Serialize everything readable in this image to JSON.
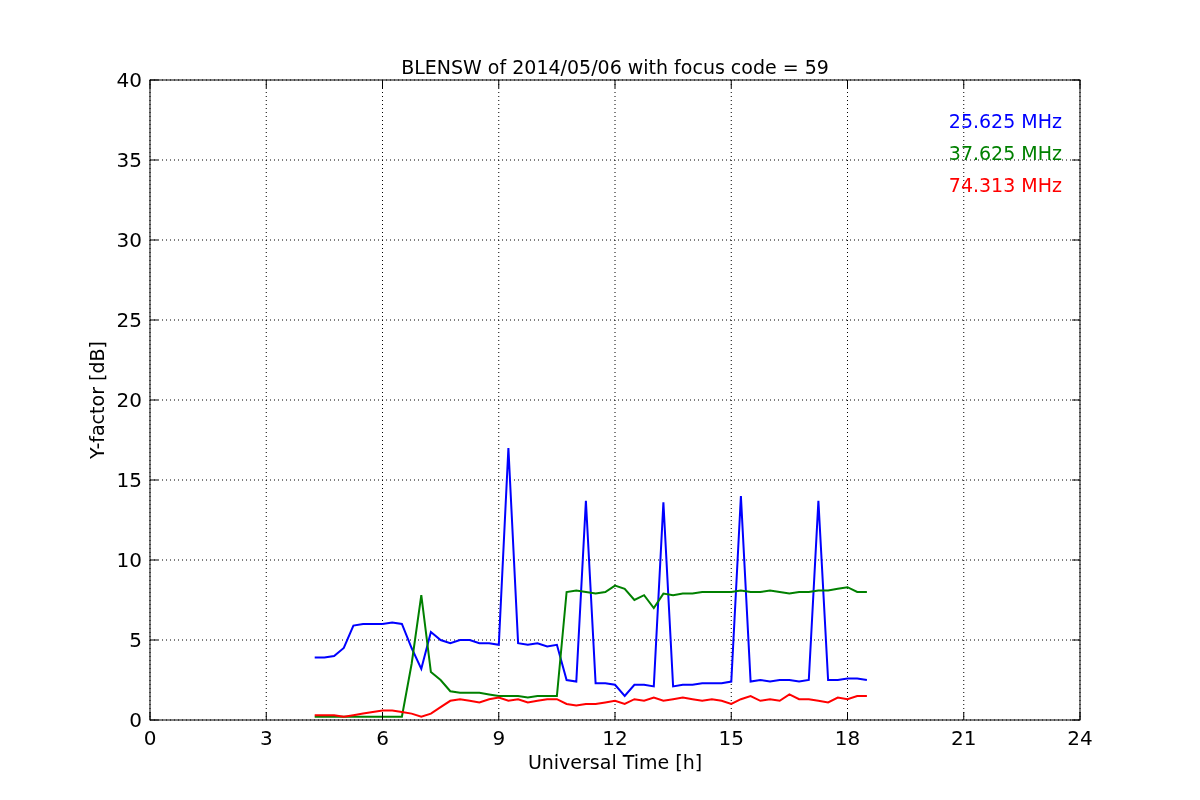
{
  "chart_data": {
    "type": "line",
    "title": "BLENSW of 2014/05/06 with focus code = 59",
    "xlabel": "Universal Time [h]",
    "ylabel": "Y-factor [dB]",
    "x": [
      4.25,
      4.5,
      4.75,
      5,
      5.25,
      5.5,
      5.75,
      6,
      6.25,
      6.5,
      6.75,
      7,
      7.25,
      7.5,
      7.75,
      8,
      8.25,
      8.5,
      8.75,
      9,
      9.25,
      9.5,
      9.75,
      10,
      10.25,
      10.5,
      10.75,
      11,
      11.25,
      11.5,
      11.75,
      12,
      12.25,
      12.5,
      12.75,
      13,
      13.25,
      13.5,
      13.75,
      14,
      14.25,
      14.5,
      14.75,
      15,
      15.25,
      15.5,
      15.75,
      16,
      16.25,
      16.5,
      16.75,
      17,
      17.25,
      17.5,
      17.75,
      18,
      18.25,
      18.5
    ],
    "series": [
      {
        "name": "25.625 MHz",
        "color": "#0000ff",
        "values": [
          3.9,
          3.9,
          4.0,
          4.5,
          5.9,
          6.0,
          6.0,
          6.0,
          6.1,
          6.0,
          4.5,
          3.2,
          5.5,
          5.0,
          4.8,
          5.0,
          5.0,
          4.8,
          4.8,
          4.7,
          17.0,
          4.8,
          4.7,
          4.8,
          4.6,
          4.7,
          2.5,
          2.4,
          13.7,
          2.3,
          2.3,
          2.2,
          1.5,
          2.2,
          2.2,
          2.1,
          13.6,
          2.1,
          2.2,
          2.2,
          2.3,
          2.3,
          2.3,
          2.4,
          14.0,
          2.4,
          2.5,
          2.4,
          2.5,
          2.5,
          2.4,
          2.5,
          13.7,
          2.5,
          2.5,
          2.6,
          2.6,
          2.5
        ]
      },
      {
        "name": "37.625 MHz",
        "color": "#008000",
        "values": [
          0.2,
          0.2,
          0.2,
          0.2,
          0.2,
          0.2,
          0.2,
          0.2,
          0.2,
          0.2,
          3.5,
          7.8,
          3.0,
          2.5,
          1.8,
          1.7,
          1.7,
          1.7,
          1.6,
          1.5,
          1.5,
          1.5,
          1.4,
          1.5,
          1.5,
          1.5,
          8.0,
          8.1,
          8.0,
          7.9,
          8.0,
          8.4,
          8.2,
          7.5,
          7.8,
          7.0,
          7.9,
          7.8,
          7.9,
          7.9,
          8.0,
          8.0,
          8.0,
          8.0,
          8.1,
          8.0,
          8.0,
          8.1,
          8.0,
          7.9,
          8.0,
          8.0,
          8.1,
          8.1,
          8.2,
          8.3,
          8.0,
          8.0
        ]
      },
      {
        "name": "74.313 MHz",
        "color": "#ff0000",
        "values": [
          0.3,
          0.3,
          0.3,
          0.2,
          0.3,
          0.4,
          0.5,
          0.6,
          0.6,
          0.5,
          0.4,
          0.2,
          0.4,
          0.8,
          1.2,
          1.3,
          1.2,
          1.1,
          1.3,
          1.4,
          1.2,
          1.3,
          1.1,
          1.2,
          1.3,
          1.3,
          1.0,
          0.9,
          1.0,
          1.0,
          1.1,
          1.2,
          1.0,
          1.3,
          1.2,
          1.4,
          1.2,
          1.3,
          1.4,
          1.3,
          1.2,
          1.3,
          1.2,
          1.0,
          1.3,
          1.5,
          1.2,
          1.3,
          1.2,
          1.6,
          1.3,
          1.3,
          1.2,
          1.1,
          1.4,
          1.3,
          1.5,
          1.5
        ]
      }
    ],
    "grid": true,
    "xlim": [
      0,
      24
    ],
    "ylim": [
      0,
      40
    ],
    "xticks": [
      0,
      3,
      6,
      9,
      12,
      15,
      18,
      21,
      24
    ],
    "yticks": [
      0,
      5,
      10,
      15,
      20,
      25,
      30,
      35,
      40
    ]
  }
}
